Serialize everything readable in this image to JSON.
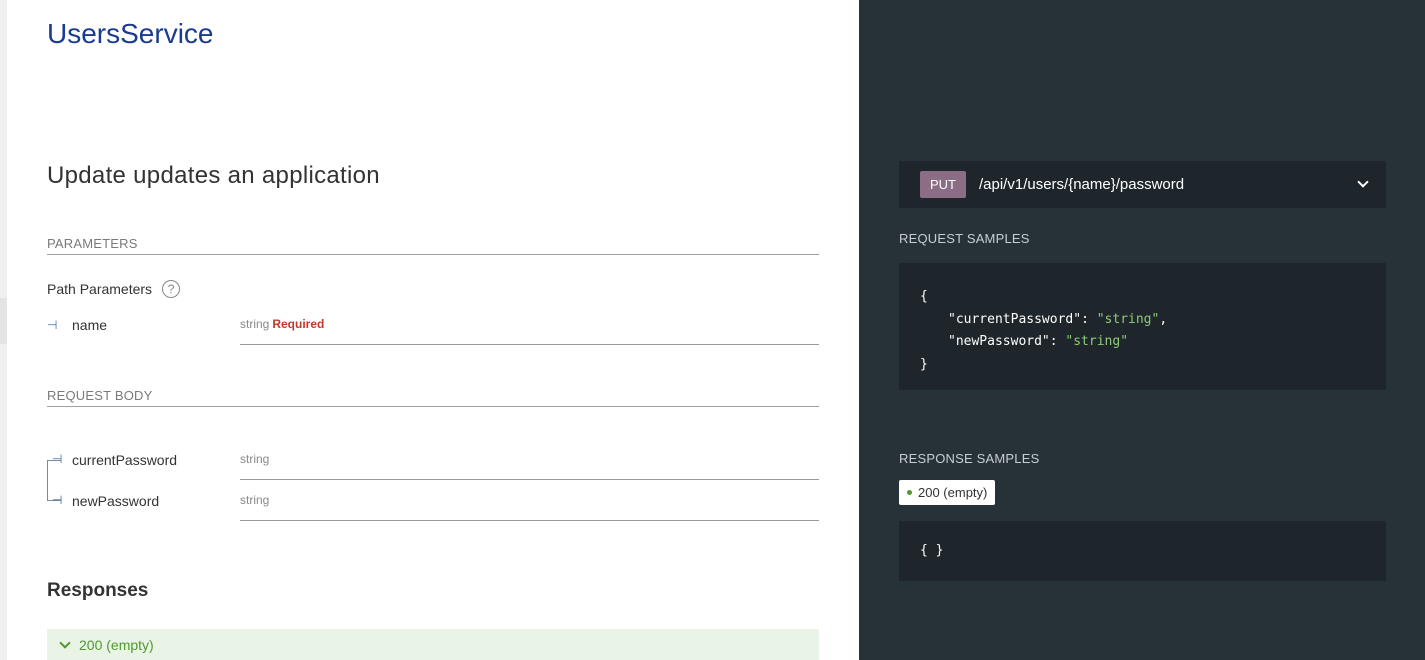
{
  "service": {
    "title": "UsersService"
  },
  "operation": {
    "title": "Update updates an application"
  },
  "parameters": {
    "heading": "PARAMETERS",
    "path_params_label": "Path Parameters",
    "help_glyph": "?",
    "items": [
      {
        "name": "name",
        "type": "string",
        "required_label": "Required"
      }
    ]
  },
  "request_body": {
    "heading": "REQUEST BODY",
    "fields": [
      {
        "name": "currentPassword",
        "type": "string"
      },
      {
        "name": "newPassword",
        "type": "string"
      }
    ]
  },
  "responses": {
    "title": "Responses",
    "items": [
      {
        "label": "200 (empty)"
      }
    ]
  },
  "endpoint": {
    "method": "PUT",
    "path": "/api/v1/users/{name}/password"
  },
  "request_samples": {
    "heading": "REQUEST SAMPLES",
    "open_brace": "{",
    "close_brace": "}",
    "lines": [
      {
        "key": "\"currentPassword\"",
        "sep": ": ",
        "value": "\"string\"",
        "trail": ","
      },
      {
        "key": "\"newPassword\"",
        "sep": ": ",
        "value": "\"string\"",
        "trail": ""
      }
    ]
  },
  "response_samples": {
    "heading": "RESPONSE SAMPLES",
    "tab_label": "200 (empty)",
    "body": "{ }"
  },
  "colors": {
    "title_blue": "#1b3b8f",
    "right_panel_bg": "#263238",
    "method_put": "#8c6d86",
    "string_green": "#8fc97a",
    "required_red": "#c0392b",
    "success_green": "#4e9a2e"
  }
}
